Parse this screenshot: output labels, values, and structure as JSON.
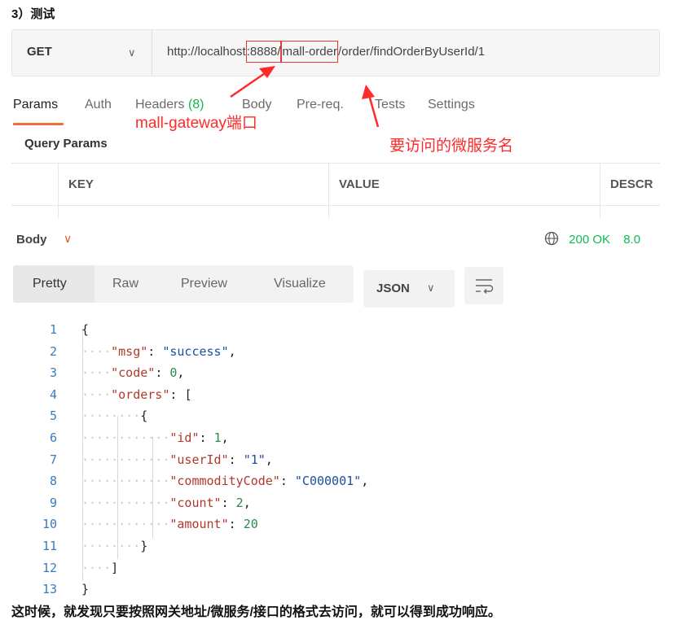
{
  "heading": "3）测试",
  "request": {
    "method": "GET",
    "url_parts": [
      "http://localhost",
      ":8888/",
      "mall-order",
      "/order/findOrderByUserId/1"
    ]
  },
  "tabs": [
    "Params",
    "Auth",
    "Headers",
    "(8)",
    "Body",
    "Pre-req.",
    "Tests",
    "Settings"
  ],
  "annotations": {
    "port": "mall-gateway端口",
    "service": "要访问的微服务名"
  },
  "query_params": {
    "title": "Query Params",
    "columns": [
      "KEY",
      "VALUE",
      "DESCR"
    ]
  },
  "response": {
    "body_label": "Body",
    "status": "200 OK",
    "time": "8.0",
    "view_modes": [
      "Pretty",
      "Raw",
      "Preview",
      "Visualize"
    ],
    "format": "JSON"
  },
  "code_lines": [
    {
      "n": "1",
      "text": "{"
    },
    {
      "n": "2",
      "key": "\"msg\"",
      "val": "\"success\"",
      "type": "s",
      "tail": ","
    },
    {
      "n": "3",
      "key": "\"code\"",
      "val": "0",
      "type": "n",
      "tail": ","
    },
    {
      "n": "4",
      "key": "\"orders\"",
      "val": "[",
      "type": "p"
    },
    {
      "n": "5",
      "text": "{"
    },
    {
      "n": "6",
      "key": "\"id\"",
      "val": "1",
      "type": "n",
      "tail": ","
    },
    {
      "n": "7",
      "key": "\"userId\"",
      "val": "\"1\"",
      "type": "s",
      "tail": ","
    },
    {
      "n": "8",
      "key": "\"commodityCode\"",
      "val": "\"C000001\"",
      "type": "s",
      "tail": ","
    },
    {
      "n": "9",
      "key": "\"count\"",
      "val": "2",
      "type": "n",
      "tail": ","
    },
    {
      "n": "10",
      "key": "\"amount\"",
      "val": "20",
      "type": "n"
    },
    {
      "n": "11",
      "text": "}"
    },
    {
      "n": "12",
      "text": "]"
    },
    {
      "n": "13",
      "text": "}"
    }
  ],
  "caption": "这时候，就发现只要按照网关地址/微服务/接口的格式去访问，就可以得到成功响应。",
  "colors": {
    "accent": "#f26b3a",
    "annotation": "#ff2a2a",
    "success": "#0cbb52"
  }
}
